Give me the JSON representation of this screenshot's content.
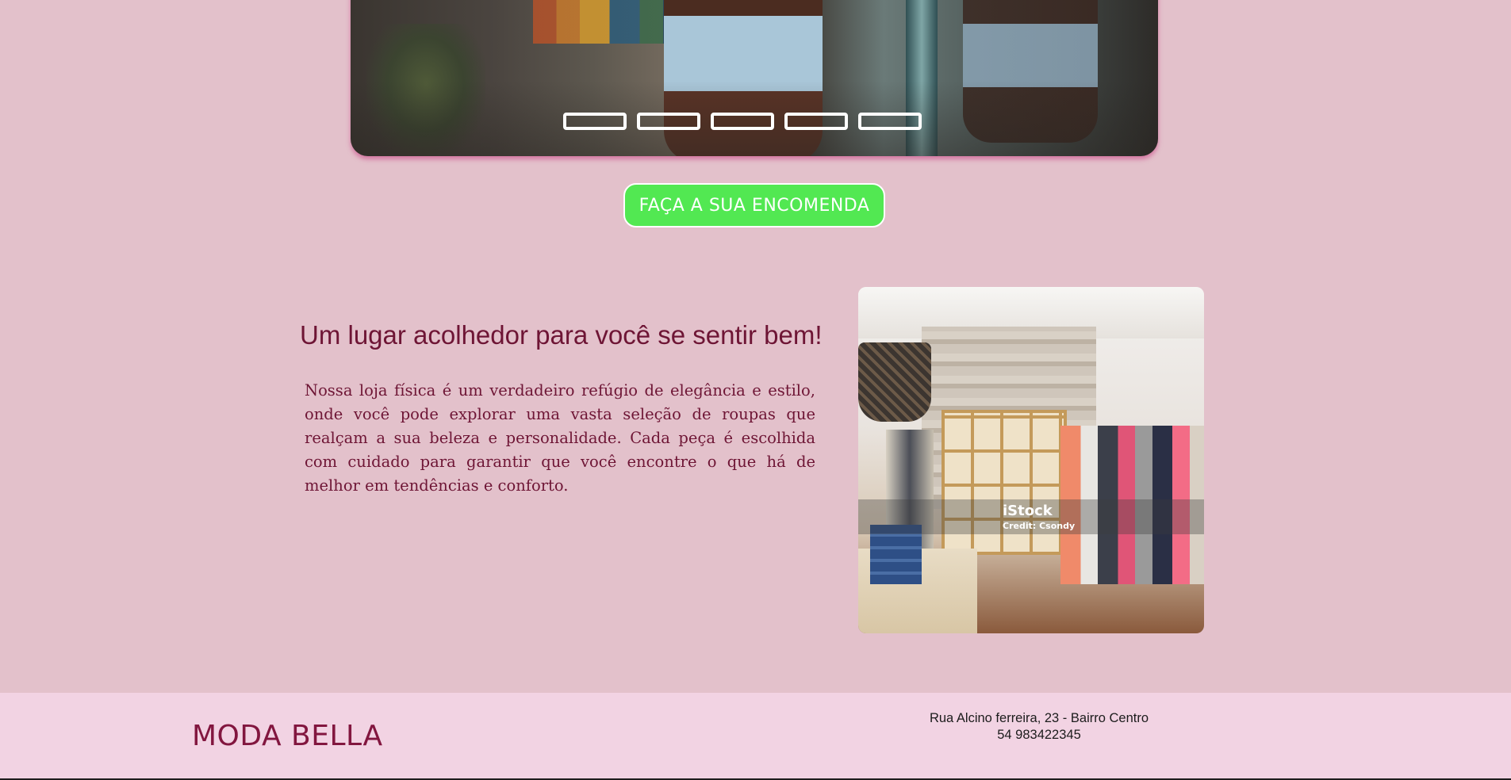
{
  "carousel": {
    "slides_count": 5,
    "indicator_labels": [
      "",
      "",
      "",
      "",
      ""
    ]
  },
  "cta": {
    "label": "FAÇA A SUA ENCOMENDA",
    "color": "#52e852"
  },
  "about": {
    "title": "Um lugar acolhedor para você se sentir bem!",
    "body": "Nossa loja física é um verdadeiro refúgio de elegância e estilo, onde você pode explorar uma vasta seleção de roupas que realçam a sua beleza e personalidade. Cada peça é escolhida com cuidado para garantir que você encontre o que há de melhor em tendências e conforto."
  },
  "store_image": {
    "watermark_brand": "iStock",
    "watermark_credit": "Credit: Csondy"
  },
  "footer": {
    "brand": "MODA BELLA",
    "address": "Rua Alcino ferreira, 23 - Bairro Centro",
    "phone": "54 983422345"
  },
  "colors": {
    "page_background": "#e3c1cb",
    "footer_background": "#f2d3e3",
    "text_accent": "#6e1535",
    "brand": "#82163f"
  }
}
